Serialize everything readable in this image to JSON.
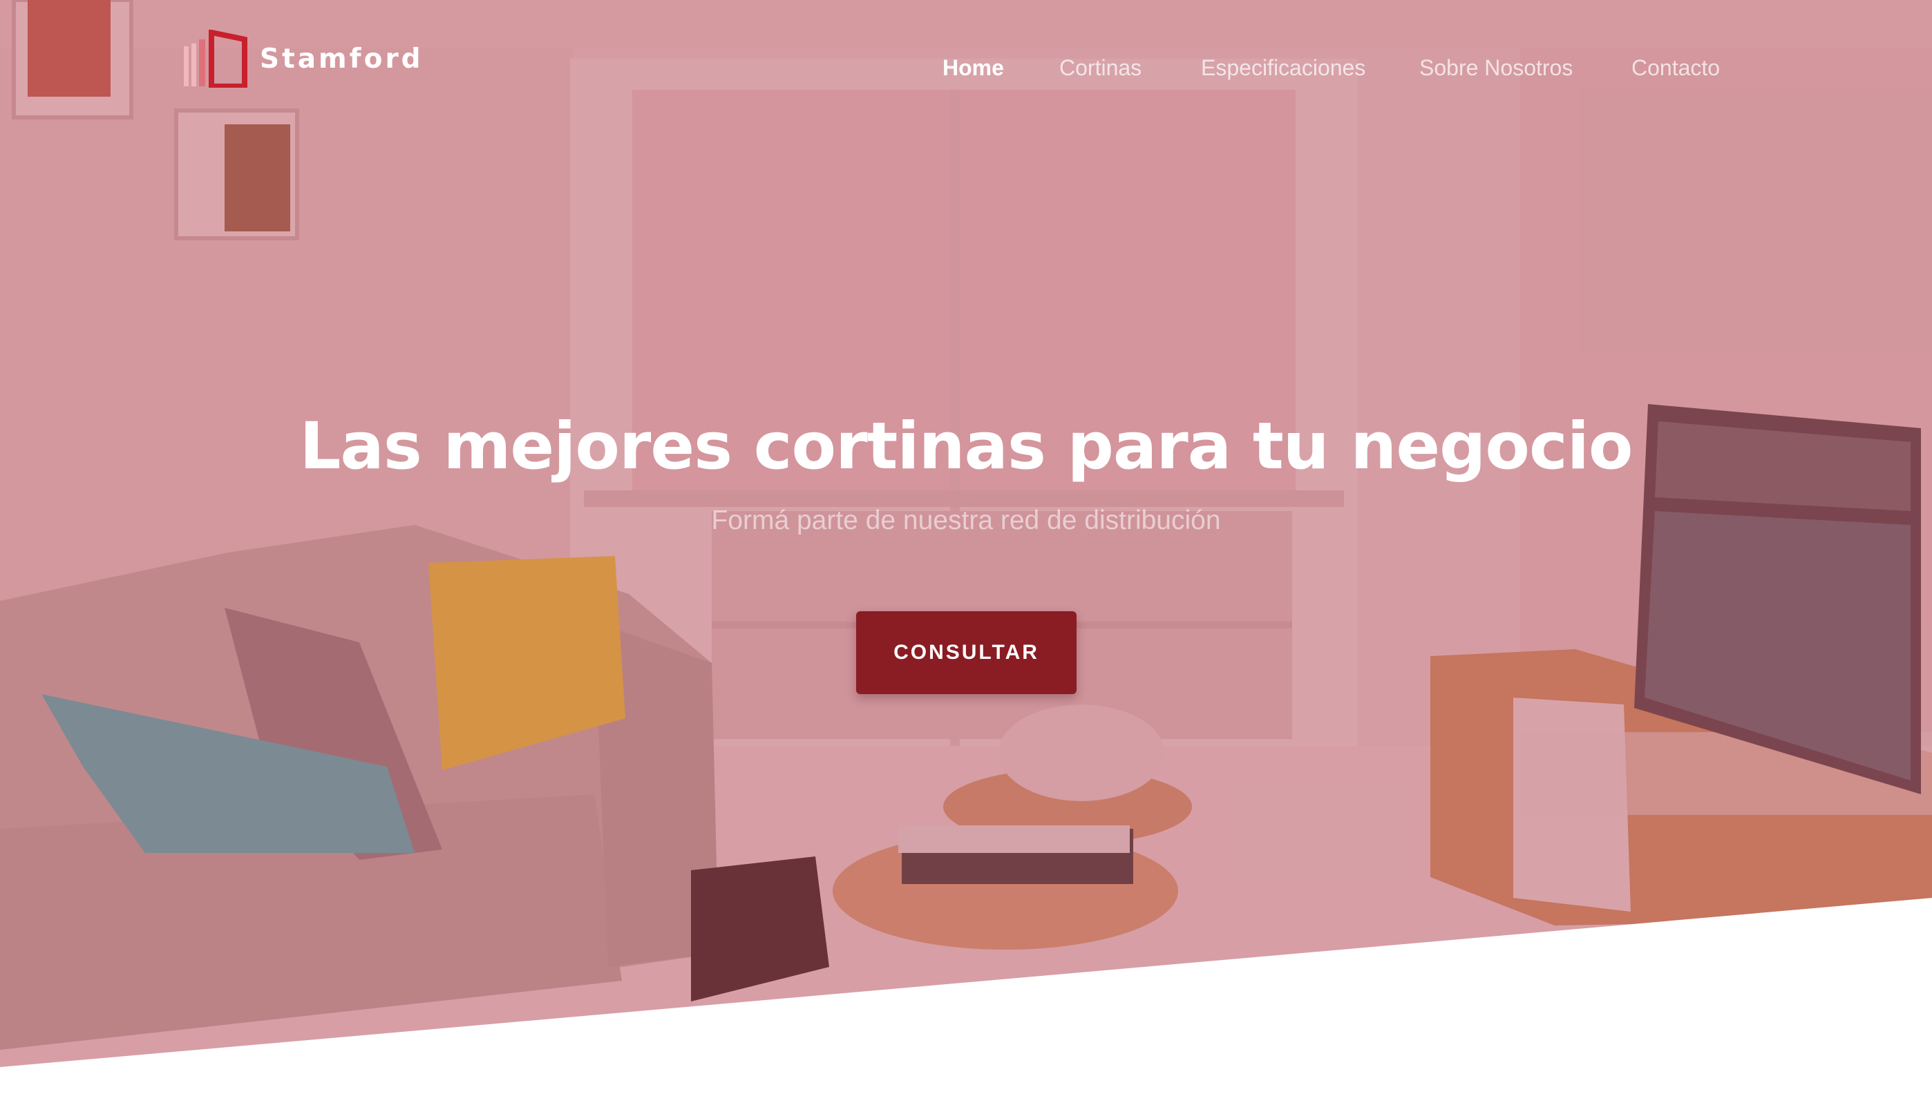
{
  "brand": {
    "name": "Stamford",
    "logo_icon": "stamford-window-logo"
  },
  "nav": {
    "items": [
      {
        "label": "Home",
        "active": true
      },
      {
        "label": "Cortinas",
        "active": false
      },
      {
        "label": "Especificaciones",
        "active": false
      },
      {
        "label": "Sobre Nosotros",
        "active": false
      },
      {
        "label": "Contacto",
        "active": false
      }
    ]
  },
  "hero": {
    "title": "Las mejores cortinas para tu negocio",
    "subtitle": "Formá parte de nuestra red de distribución",
    "cta_label": "CONSULTAR",
    "background": "living-room-photo"
  },
  "colors": {
    "overlay": "#b24854",
    "cta": "#8a1c24",
    "logo_red": "#c8202c",
    "logo_light": "#f0b8bc"
  }
}
